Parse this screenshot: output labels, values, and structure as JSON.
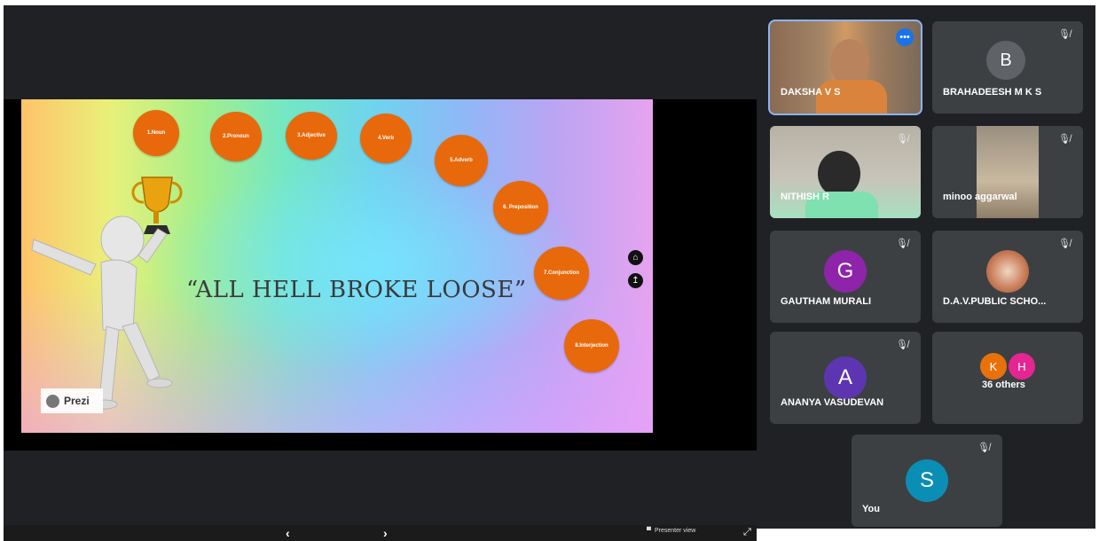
{
  "presentation": {
    "topics": [
      "1.Noun",
      "2.Pronoun",
      "3.Adjective",
      "4.Verb",
      "5.Adverb",
      "6. Preposition",
      "7.Conjunction",
      "8.Interjection"
    ],
    "title": "“ALL HELL BROKE LOOSE”",
    "brand": "Prezi",
    "prev_icon": "‹",
    "next_icon": "›",
    "presenter_view_label": "Presenter view",
    "colors": {
      "circle": "#e8690b"
    }
  },
  "participants": [
    {
      "name": "DAKSHA V S",
      "type": "video",
      "initial": ""
    },
    {
      "name": "BRAHADEESH M K S",
      "type": "avatar",
      "initial": "B",
      "avatar_color": "#3c4043"
    },
    {
      "name": "NITHISH R",
      "type": "video",
      "initial": ""
    },
    {
      "name": "minoo aggarwal",
      "type": "video",
      "initial": ""
    },
    {
      "name": "GAUTHAM MURALI",
      "type": "avatar",
      "initial": "G",
      "avatar_color": "#8e24aa"
    },
    {
      "name": "D.A.V.PUBLIC SCHO...",
      "type": "logo",
      "initial": ""
    },
    {
      "name": "ANANYA VASUDEVAN",
      "type": "avatar",
      "initial": "A",
      "avatar_color": "#5e35b1"
    },
    {
      "name": "36 others",
      "type": "group",
      "initials": [
        "K",
        "H"
      ]
    },
    {
      "name": "You",
      "type": "avatar",
      "initial": "S",
      "avatar_color": "#0b8eb5"
    }
  ]
}
